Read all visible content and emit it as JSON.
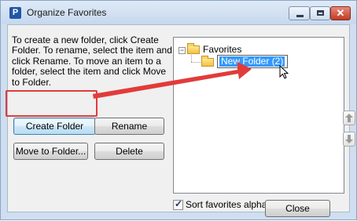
{
  "window": {
    "title": "Organize Favorites",
    "app_icon_letter": "P",
    "close_glyph": "✕"
  },
  "instructions": "To create a new folder, click Create Folder.  To rename, select the item and click Rename.  To move an item to a folder, select the item and click Move to Folder.",
  "buttons": {
    "create_folder": "Create Folder",
    "rename": "Rename",
    "move_to_folder": "Move to Folder...",
    "delete": "Delete",
    "close": "Close"
  },
  "tree": {
    "root_label": "Favorites",
    "expander": "−",
    "editing_label": "New Folder (2)"
  },
  "sort": {
    "label": "Sort favorites alpha",
    "checked": true
  },
  "colors": {
    "annotation_red": "#e23b3b",
    "selection_blue": "#3399ff"
  }
}
